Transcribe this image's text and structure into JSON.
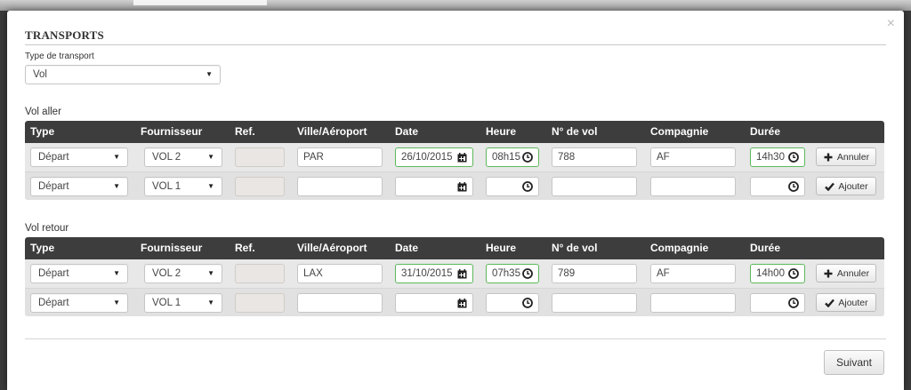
{
  "modal": {
    "title": "TRANSPORTS",
    "close_label": "×",
    "transport_type": {
      "label": "Type de transport",
      "value": "Vol"
    },
    "next_button": "Suivant"
  },
  "columns": [
    "Type",
    "Fournisseur",
    "Ref.",
    "Ville/Aéroport",
    "Date",
    "Heure",
    "N° de vol",
    "Compagnie",
    "Durée"
  ],
  "outbound": {
    "label": "Vol aller",
    "rows": [
      {
        "type": "Départ",
        "supplier": "VOL 2",
        "ref": "",
        "city": "PAR",
        "date": "26/10/2015",
        "time": "08h15",
        "flight_no": "788",
        "company": "AF",
        "duration": "14h30",
        "action": "Annuler",
        "action_icon": "plus-icon",
        "filled": true
      },
      {
        "type": "Départ",
        "supplier": "VOL 1",
        "ref": "",
        "city": "",
        "date": "",
        "time": "",
        "flight_no": "",
        "company": "",
        "duration": "",
        "action": "Ajouter",
        "action_icon": "check-icon",
        "filled": false
      }
    ]
  },
  "return": {
    "label": "Vol retour",
    "rows": [
      {
        "type": "Départ",
        "supplier": "VOL 2",
        "ref": "",
        "city": "LAX",
        "date": "31/10/2015",
        "time": "07h35",
        "flight_no": "789",
        "company": "AF",
        "duration": "14h00",
        "action": "Annuler",
        "action_icon": "plus-icon",
        "filled": true
      },
      {
        "type": "Départ",
        "supplier": "VOL 1",
        "ref": "",
        "city": "",
        "date": "",
        "time": "",
        "flight_no": "",
        "company": "",
        "duration": "",
        "action": "Ajouter",
        "action_icon": "check-icon",
        "filled": false
      }
    ]
  },
  "colors": {
    "header_bg": "#3d3d3d",
    "valid_border": "#5cb85c",
    "readonly_bg": "#e9e6e3"
  }
}
